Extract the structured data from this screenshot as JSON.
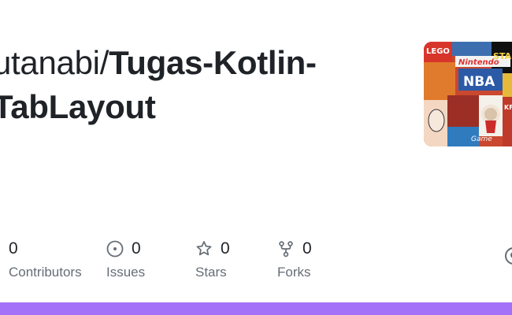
{
  "repo": {
    "owner": "utanabi/",
    "name": "Tugas-Kotlin-TabLayout"
  },
  "avatar": {
    "icon": "collage-avatar-image",
    "words": [
      "LEGO",
      "Nintendo",
      "NBA",
      "STAR WARS",
      "KFC",
      "Game"
    ]
  },
  "stats": {
    "contributors": {
      "value": "0",
      "label": "Contributors",
      "icon": "people-icon"
    },
    "issues": {
      "value": "0",
      "label": "Issues",
      "icon": "issue-circle-icon"
    },
    "stars": {
      "value": "0",
      "label": "Stars",
      "icon": "star-icon"
    },
    "forks": {
      "value": "0",
      "label": "Forks",
      "icon": "fork-icon"
    }
  },
  "colors": {
    "text": "#1f2328",
    "muted": "#656d76",
    "bar": "#a371f7"
  }
}
